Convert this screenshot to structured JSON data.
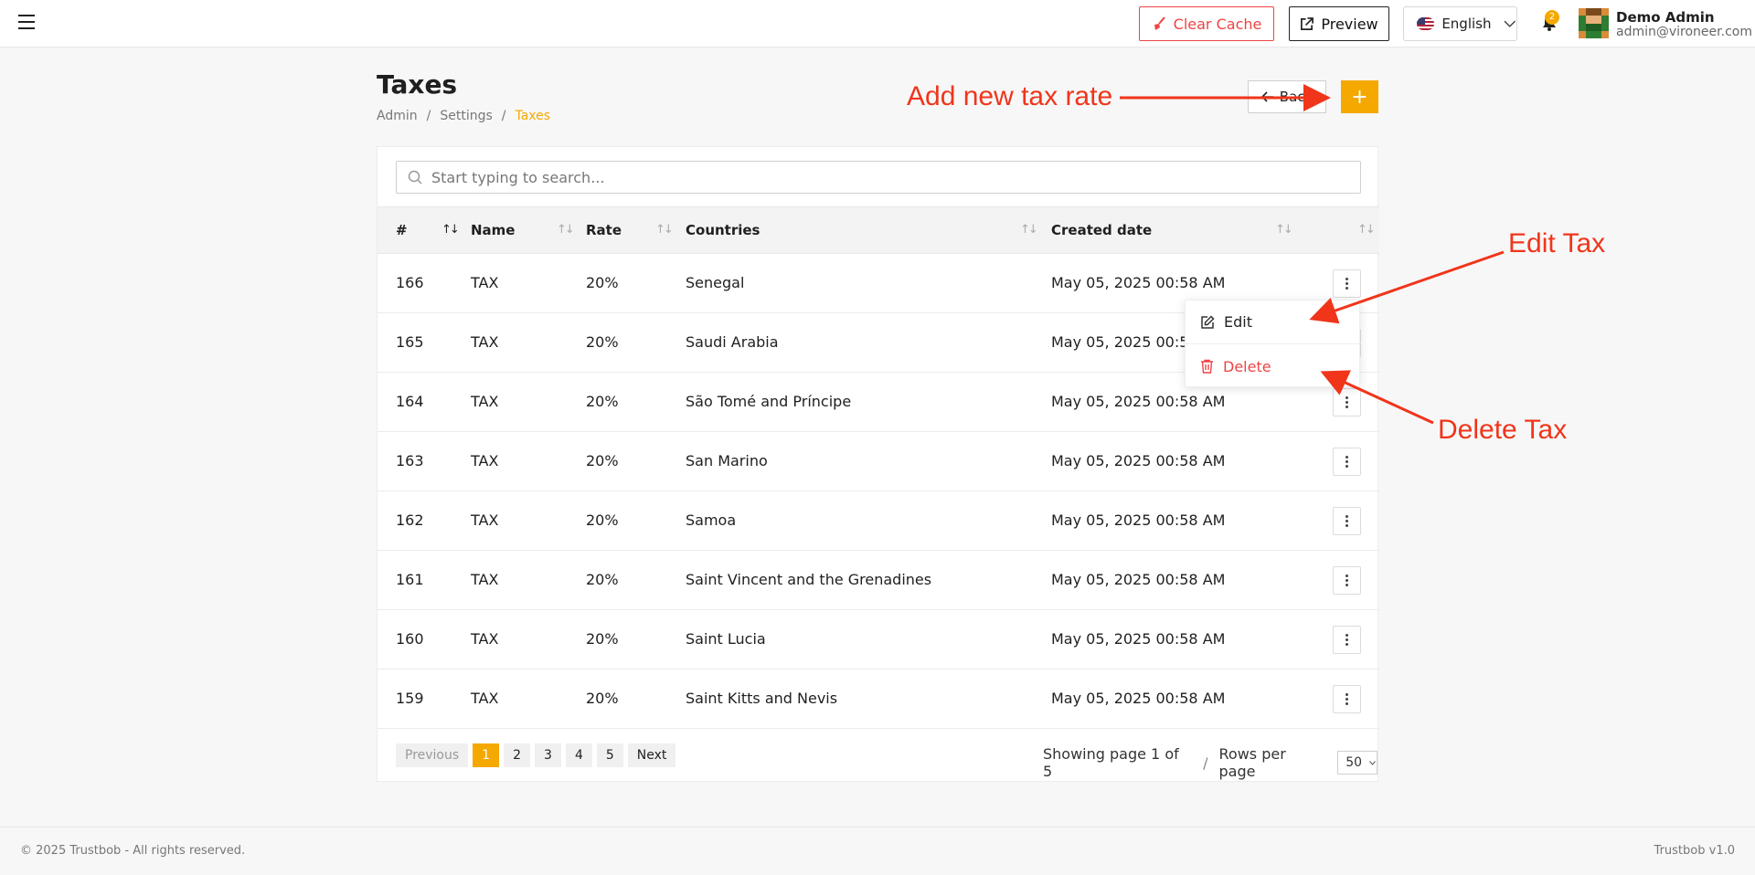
{
  "topbar": {
    "clear_cache": "Clear Cache",
    "preview": "Preview",
    "language": "English",
    "notification_count": "2",
    "user_name": "Demo Admin",
    "user_email": "admin@vironeer.com"
  },
  "header": {
    "title": "Taxes",
    "breadcrumb": [
      "Admin",
      "Settings",
      "Taxes"
    ],
    "back_label": "Back",
    "add_label": "+"
  },
  "search": {
    "placeholder": "Start typing to search..."
  },
  "table": {
    "columns": [
      "#",
      "Name",
      "Rate",
      "Countries",
      "Created date"
    ],
    "rows": [
      {
        "id": "166",
        "name": "TAX",
        "rate": "20%",
        "country": "Senegal",
        "date": "May 05, 2025 00:58 AM"
      },
      {
        "id": "165",
        "name": "TAX",
        "rate": "20%",
        "country": "Saudi Arabia",
        "date": "May 05, 2025 00:58 AM"
      },
      {
        "id": "164",
        "name": "TAX",
        "rate": "20%",
        "country": "São Tomé and Príncipe",
        "date": "May 05, 2025 00:58 AM"
      },
      {
        "id": "163",
        "name": "TAX",
        "rate": "20%",
        "country": "San Marino",
        "date": "May 05, 2025 00:58 AM"
      },
      {
        "id": "162",
        "name": "TAX",
        "rate": "20%",
        "country": "Samoa",
        "date": "May 05, 2025 00:58 AM"
      },
      {
        "id": "161",
        "name": "TAX",
        "rate": "20%",
        "country": "Saint Vincent and the Grenadines",
        "date": "May 05, 2025 00:58 AM"
      },
      {
        "id": "160",
        "name": "TAX",
        "rate": "20%",
        "country": "Saint Lucia",
        "date": "May 05, 2025 00:58 AM"
      },
      {
        "id": "159",
        "name": "TAX",
        "rate": "20%",
        "country": "Saint Kitts and Nevis",
        "date": "May 05, 2025 00:58 AM"
      }
    ]
  },
  "dropdown": {
    "edit": "Edit",
    "delete": "Delete"
  },
  "pagination": {
    "previous": "Previous",
    "pages": [
      "1",
      "2",
      "3",
      "4",
      "5"
    ],
    "next": "Next",
    "info": "Showing page 1 of 5",
    "separator": "/",
    "rows_label": "Rows per page",
    "rows_value": "50"
  },
  "annotations": {
    "add": "Add new tax rate",
    "edit": "Edit Tax",
    "delete": "Delete Tax"
  },
  "footer": {
    "copyright": "© 2025 Trustbob - All rights reserved.",
    "version": "Trustbob v1.0"
  },
  "colors": {
    "accent": "#f5a800",
    "danger": "#ef4444",
    "annotation": "#f0351a"
  }
}
